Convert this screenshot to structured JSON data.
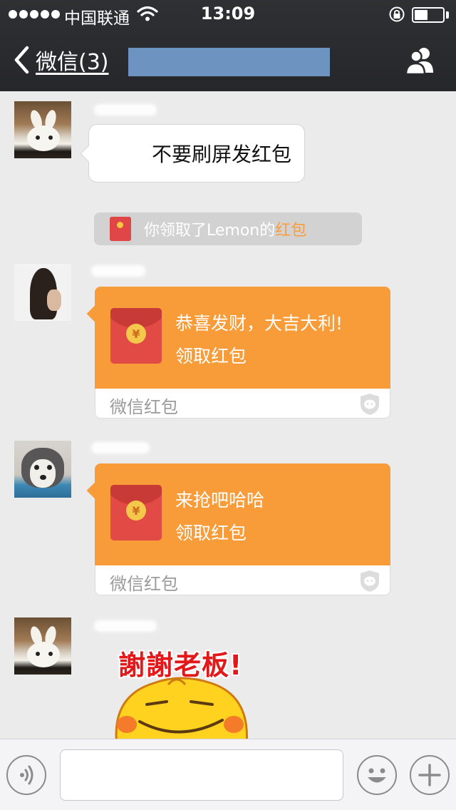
{
  "status_bar": {
    "carrier": "中国联通",
    "time": "13:09",
    "icons": [
      "signal-dots-icon",
      "wifi-icon",
      "rotation-lock-icon",
      "battery-icon"
    ]
  },
  "nav": {
    "back_label": "微信(3)",
    "back_icon": "chevron-left-icon",
    "contacts_icon": "group-members-icon"
  },
  "messages": [
    {
      "type": "text",
      "text": "不要刷屏发红包",
      "avatar": "rabbit"
    },
    {
      "type": "system",
      "prefix": "你领取了Lemon的",
      "link": "红包",
      "icon": "red-packet-icon"
    },
    {
      "type": "red_packet",
      "avatar": "girl",
      "greeting": "恭喜发财，大吉大利!",
      "action": "领取红包",
      "brand": "微信红包"
    },
    {
      "type": "red_packet",
      "avatar": "husky",
      "greeting": "来抢吧哈哈",
      "action": "领取红包",
      "brand": "微信红包"
    },
    {
      "type": "sticker",
      "avatar": "rabbit",
      "caption": "謝謝老板!"
    }
  ],
  "input_bar": {
    "value": "",
    "voice_icon": "voice-icon",
    "emoji_icon": "emoji-icon",
    "more_icon": "plus-icon"
  },
  "colors": {
    "nav_bg": "#2b2c2f",
    "chat_bg": "#ebebeb",
    "packet_orange": "#f79c38",
    "packet_red": "#e14a45",
    "link_orange": "#fa9d3b",
    "sticker_red": "#e2181a"
  }
}
